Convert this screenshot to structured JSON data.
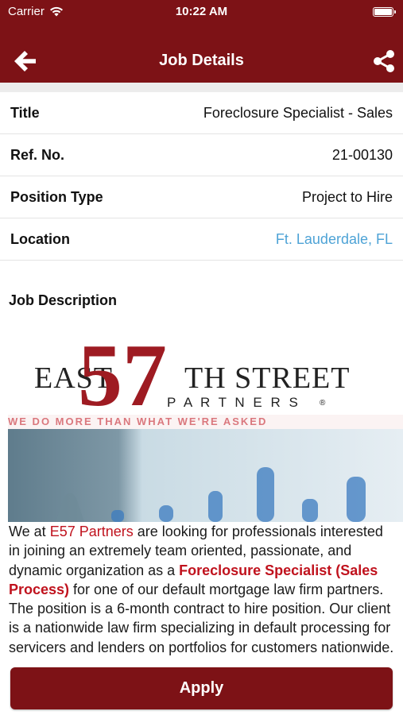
{
  "status_bar": {
    "carrier": "Carrier",
    "time": "10:22 AM"
  },
  "nav": {
    "title": "Job Details"
  },
  "details": [
    {
      "label": "Title",
      "value": "Foreclosure Specialist - Sales"
    },
    {
      "label": "Ref. No.",
      "value": "21-00130"
    },
    {
      "label": "Position Type",
      "value": "Project to Hire"
    },
    {
      "label": "Location",
      "value": "Ft. Lauderdale, FL"
    }
  ],
  "description": {
    "heading": "Job Description",
    "logo": {
      "east": "EAST",
      "number": "57",
      "th_street": "TH STREET",
      "partners": "P A R T N E R S",
      "registered": "®"
    },
    "banner_tagline": "WE DO MORE THAN WHAT WE'RE ASKED",
    "body_1": "We at ",
    "company_link": "E57 Partners",
    "body_2": " are looking for professionals interested in joining an extremely team oriented, passionate, and dynamic organization as a ",
    "position_highlight": "Foreclosure Specialist (Sales Process)",
    "body_3": " for one of our default mortgage law firm partners. The position is a 6-month contract to hire position. Our client is a nationwide law firm specializing in default processing for servicers and lenders on portfolios for customers nationwide."
  },
  "apply_label": "Apply",
  "colors": {
    "brand": "#7d1216",
    "link": "#4ea3d6",
    "accent_red": "#c0121d"
  }
}
